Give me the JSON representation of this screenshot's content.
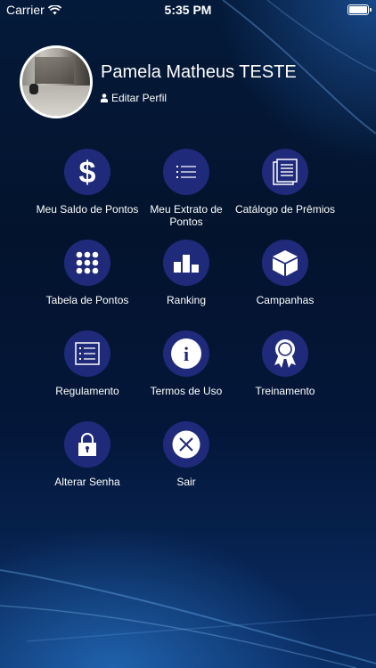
{
  "status_bar": {
    "carrier": "Carrier",
    "time": "5:35 PM"
  },
  "profile": {
    "name": "Pamela Matheus TESTE",
    "edit_label": "Editar Perfil"
  },
  "menu": {
    "items": [
      {
        "label": "Meu Saldo de Pontos",
        "icon": "dollar-icon"
      },
      {
        "label": "Meu Extrato de Pontos",
        "icon": "list-icon"
      },
      {
        "label": "Catálogo de Prêmios",
        "icon": "catalog-icon"
      },
      {
        "label": "Tabela de Pontos",
        "icon": "grid-dots-icon"
      },
      {
        "label": "Ranking",
        "icon": "ranking-icon"
      },
      {
        "label": "Campanhas",
        "icon": "box-icon"
      },
      {
        "label": "Regulamento",
        "icon": "document-icon"
      },
      {
        "label": "Termos de Uso",
        "icon": "info-icon"
      },
      {
        "label": "Treinamento",
        "icon": "award-icon"
      },
      {
        "label": "Alterar Senha",
        "icon": "lock-icon"
      },
      {
        "label": "Sair",
        "icon": "close-icon"
      }
    ]
  },
  "colors": {
    "icon_circle": "#1f2a7a",
    "background": "#03132d"
  }
}
